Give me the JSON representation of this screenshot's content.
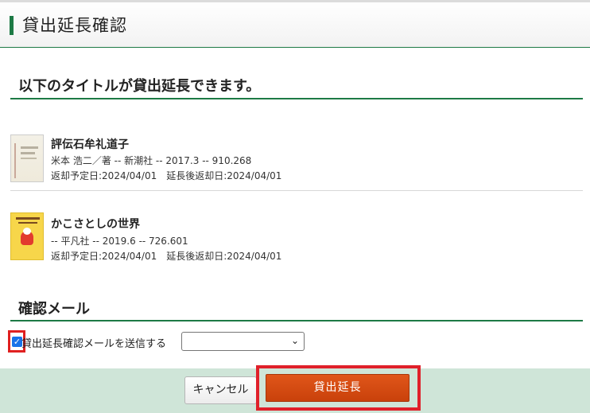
{
  "header": {
    "title": "貸出延長確認"
  },
  "books_section": {
    "heading": "以下のタイトルが貸出延長できます。"
  },
  "books": [
    {
      "title": "評伝石牟礼道子",
      "meta": "米本 浩二／著 -- 新潮社 -- 2017.3 -- 910.268",
      "dates": "返却予定日:2024/04/01　延長後返却日:2024/04/01"
    },
    {
      "title": "かこさとしの世界",
      "meta": "-- 平凡社 -- 2019.6 -- 726.601",
      "dates": "返却予定日:2024/04/01　延長後返却日:2024/04/01"
    }
  ],
  "mail_section": {
    "heading": "確認メール",
    "checkbox_label": "貸出延長確認メールを送信する",
    "checkbox_checked": true,
    "select_value": ""
  },
  "footer": {
    "cancel_label": "キャンセル",
    "submit_label": "貸出延長"
  },
  "colors": {
    "accent": "#1d7a45",
    "submit": "#d24a12",
    "footer_bg": "#cfe5d8",
    "highlight": "#e0202a"
  }
}
